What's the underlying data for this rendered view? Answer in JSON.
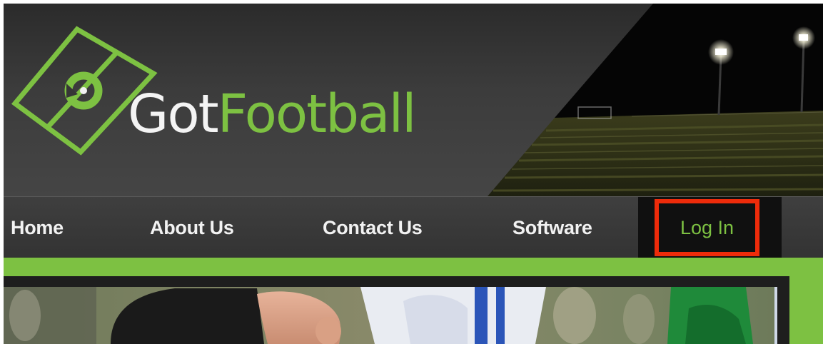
{
  "brand": {
    "name_part1": "Got",
    "name_part2": "Football",
    "accent_color": "#7dc142",
    "logo_icon": "soccer-field-icon"
  },
  "nav": {
    "items": [
      {
        "label": "Home"
      },
      {
        "label": "About Us"
      },
      {
        "label": "Contact Us"
      },
      {
        "label": "Software"
      }
    ],
    "login": {
      "label": "Log In",
      "highlight_color": "#ee2b0a"
    }
  },
  "header_photo": {
    "subject": "night football field under floodlights"
  },
  "hero": {
    "subject": "football players in action"
  }
}
